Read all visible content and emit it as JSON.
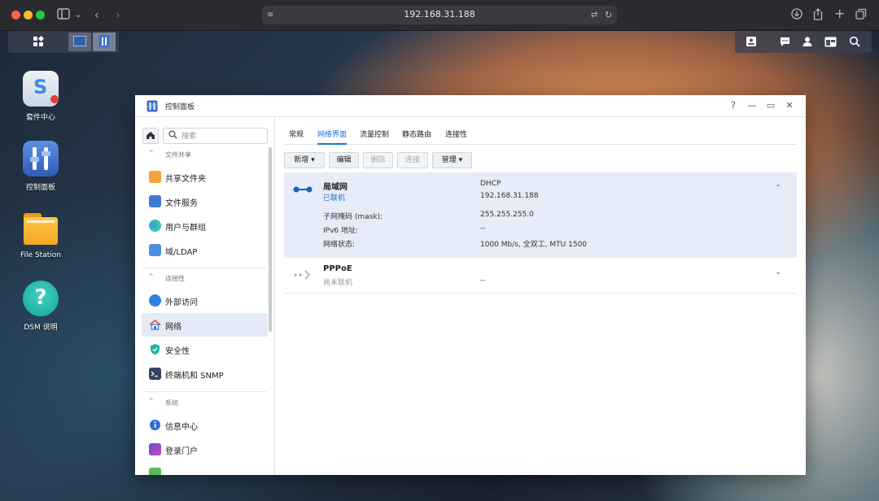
{
  "browser": {
    "url": "192.168.31.188"
  },
  "desktop": {
    "icons": [
      {
        "label": "套件中心"
      },
      {
        "label": "控制面板"
      },
      {
        "label": "File Station"
      },
      {
        "label": "DSM 说明"
      }
    ]
  },
  "window": {
    "title": "控制面板",
    "controls": {
      "help": "?",
      "minimize": "—",
      "maximize": "▭",
      "close": "✕"
    }
  },
  "sidebar": {
    "search_placeholder": "搜索",
    "sections": [
      {
        "label": "文件共享",
        "items": [
          {
            "label": "共享文件夹"
          },
          {
            "label": "文件服务"
          },
          {
            "label": "用户与群组"
          },
          {
            "label": "域/LDAP"
          }
        ]
      },
      {
        "label": "连接性",
        "items": [
          {
            "label": "外部访问"
          },
          {
            "label": "网络"
          },
          {
            "label": "安全性"
          },
          {
            "label": "终端机和 SNMP"
          }
        ]
      },
      {
        "label": "系统",
        "items": [
          {
            "label": "信息中心"
          },
          {
            "label": "登录门户"
          }
        ]
      }
    ],
    "active_item": "网络"
  },
  "tabs": [
    {
      "label": "常规"
    },
    {
      "label": "网络界面"
    },
    {
      "label": "流量控制"
    },
    {
      "label": "静态路由"
    },
    {
      "label": "连接性"
    }
  ],
  "active_tab": "网络界面",
  "toolbar": {
    "create": "新增 ▾",
    "edit": "编辑",
    "delete": "删除",
    "connect": "连接",
    "manage": "管理 ▾"
  },
  "interfaces": [
    {
      "name": "局域网",
      "status": "已联机",
      "mode": "DHCP",
      "ip": "192.168.31.188",
      "details": [
        {
          "label": "子网掩码 (mask):",
          "value": "255.255.255.0"
        },
        {
          "label": "IPv6 地址:",
          "value": "--"
        },
        {
          "label": "网络状态:",
          "value": "1000 Mb/s, 全双工, MTU 1500"
        }
      ]
    },
    {
      "name": "PPPoE",
      "status": "尚未联机",
      "ip": "--"
    }
  ],
  "colors": {
    "accent": "#1d6fd6",
    "active_row": "#e6edf9",
    "active_nav": "#e4eaf6"
  }
}
